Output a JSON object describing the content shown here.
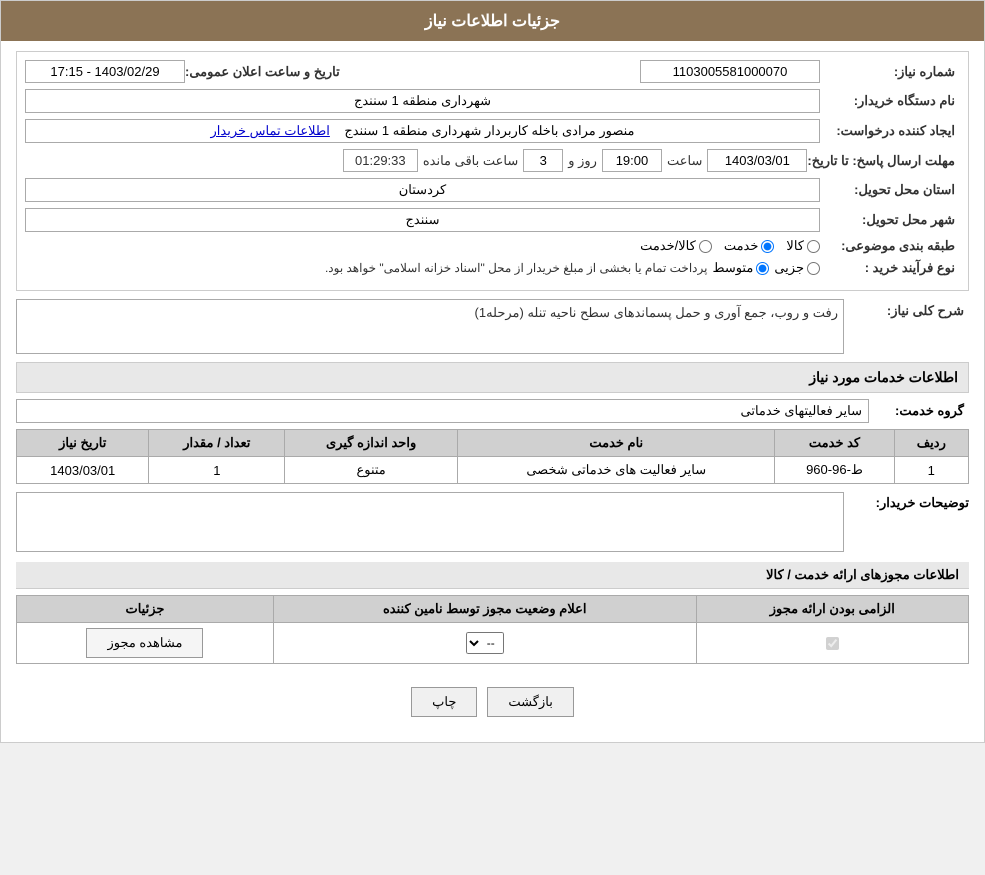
{
  "page": {
    "title": "جزئیات اطلاعات نیاز"
  },
  "header": {
    "need_number_label": "شماره نیاز:",
    "need_number_value": "1103005581000070",
    "public_announce_label": "تاریخ و ساعت اعلان عمومی:",
    "public_announce_value": "1403/02/29 - 17:15",
    "buyer_org_label": "نام دستگاه خریدار:",
    "buyer_org_value": "شهرداری منطقه 1 سنندج",
    "requester_label": "ایجاد کننده درخواست:",
    "requester_value": "منصور مرادی باخله کاربردار شهرداری منطقه 1 سنندج",
    "requester_link": "اطلاعات تماس خریدار",
    "deadline_label": "مهلت ارسال پاسخ: تا تاریخ:",
    "deadline_date": "1403/03/01",
    "deadline_time_label": "ساعت",
    "deadline_time": "19:00",
    "deadline_day_label": "روز و",
    "deadline_days": "3",
    "deadline_remaining_label": "ساعت باقی مانده",
    "deadline_remaining": "01:29:33",
    "province_label": "استان محل تحویل:",
    "province_value": "کردستان",
    "city_label": "شهر محل تحویل:",
    "city_value": "سنندج",
    "category_label": "طبقه بندی موضوعی:",
    "category_options": [
      "کالا",
      "خدمت",
      "کالا/خدمت"
    ],
    "category_selected": "خدمت",
    "purchase_type_label": "نوع فرآیند خرید :",
    "purchase_type_options": [
      "جزیی",
      "متوسط"
    ],
    "purchase_type_text": "پرداخت تمام یا بخشی از مبلغ خریدار از محل \"اسناد خزانه اسلامی\" خواهد بود.",
    "description_label": "شرح کلی نیاز:",
    "description_value": "رفت و روب، جمع آوری و حمل پسماندهای سطح ناحیه تنله (مرحله1)"
  },
  "services": {
    "section_title": "اطلاعات خدمات مورد نیاز",
    "group_label": "گروه خدمت:",
    "group_value": "سایر فعالیتهای خدماتی",
    "table": {
      "columns": [
        "ردیف",
        "کد خدمت",
        "نام خدمت",
        "واحد اندازه گیری",
        "تعداد / مقدار",
        "تاریخ نیاز"
      ],
      "rows": [
        {
          "row_num": "1",
          "service_code": "ط-96-960",
          "service_name": "سایر فعالیت های خدماتی شخصی",
          "unit": "متنوع",
          "quantity": "1",
          "date": "1403/03/01"
        }
      ]
    }
  },
  "buyer_notes": {
    "label": "توضیحات خریدار:",
    "value": ""
  },
  "license": {
    "section_title": "اطلاعات مجوزهای ارائه خدمت / کالا",
    "table": {
      "columns": [
        "الزامی بودن ارائه مجوز",
        "اعلام وضعیت مجوز توسط نامین کننده",
        "جزئیات"
      ],
      "rows": [
        {
          "required": true,
          "status": "--",
          "details_btn": "مشاهده مجوز"
        }
      ]
    }
  },
  "buttons": {
    "print": "چاپ",
    "back": "بازگشت"
  }
}
